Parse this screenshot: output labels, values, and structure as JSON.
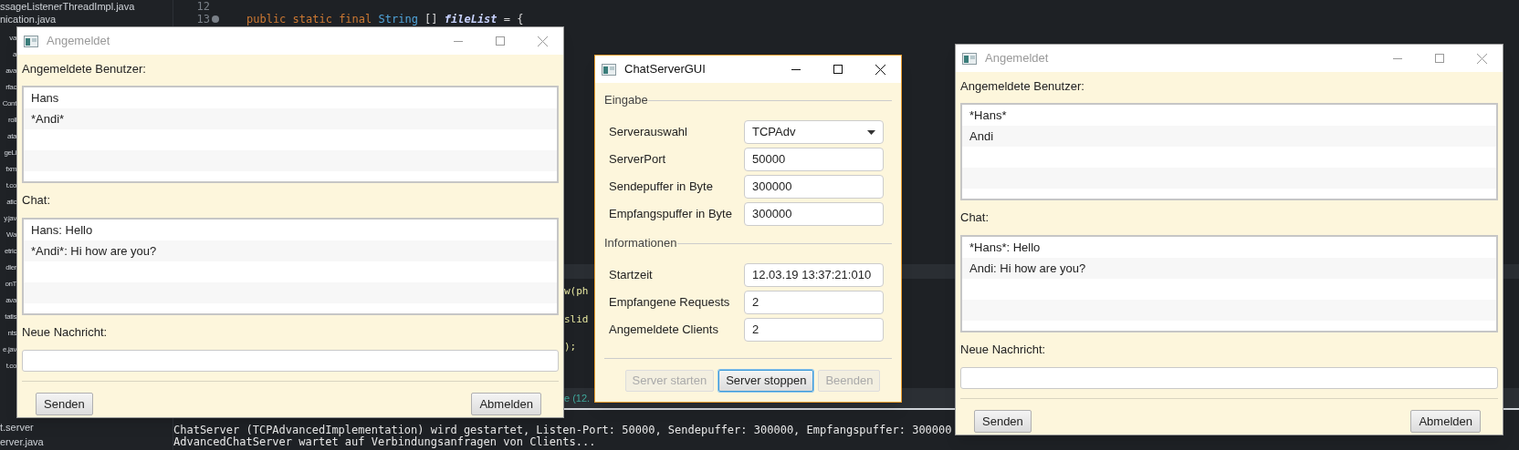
{
  "ide": {
    "file_tree": [
      "ssageListenerThreadImpl.java",
      "nication.java",
      "va",
      "a",
      "ava",
      "rfac",
      "Cont",
      "roll",
      "ata",
      "geLi",
      "fxm",
      "t.co",
      "atic",
      "y.jav",
      "Wa",
      "etric",
      "dler",
      "onT",
      "ava",
      "tatis",
      "nts",
      "e.jav",
      "t.co",
      "t.server",
      "erver.java"
    ],
    "editor": {
      "lines": [
        {
          "number": "12",
          "folded": false
        },
        {
          "number": "13",
          "folded": true,
          "tokens": [
            {
              "kind": "keyword",
              "text": "public static final"
            },
            {
              "kind": "type",
              "text": "String"
            },
            {
              "kind": "plain",
              "text": "[]"
            },
            {
              "kind": "field",
              "text": "fileList"
            },
            {
              "kind": "plain",
              "text": "= {"
            }
          ]
        }
      ],
      "fragments": [
        "w(ph",
        "slid",
        ");"
      ]
    },
    "console_tab": "e (12.",
    "console": [
      "ChatServer (TCPAdvancedImplementation) wird gestartet, Listen-Port: 50000, Sendepuffer: 300000, Empfangspuffer: 300000",
      "AdvancedChatServer wartet auf Verbindungsanfragen von Clients..."
    ]
  },
  "windows": [
    {
      "kind": "client",
      "title": "Angemeldet",
      "active": false,
      "users_label": "Angemeldete Benutzer:",
      "users": [
        "Hans",
        "*Andi*"
      ],
      "chat_label": "Chat:",
      "messages": [
        "Hans: Hello",
        "*Andi*: Hi how are you?"
      ],
      "message_label": "Neue Nachricht:",
      "buttons": [
        {
          "label": "Senden"
        },
        {
          "label": "Abmelden"
        }
      ]
    },
    {
      "kind": "server",
      "title": "ChatServerGUI",
      "active": true,
      "sections": [
        {
          "title": "Eingabe",
          "rows": [
            {
              "label": "Serverauswahl",
              "kind": "dropdown",
              "value": "TCPAdv"
            },
            {
              "label": "ServerPort",
              "kind": "text",
              "value": "50000"
            },
            {
              "label": "Sendepuffer in Byte",
              "kind": "text",
              "value": "300000"
            },
            {
              "label": "Empfangspuffer in Byte",
              "kind": "text",
              "value": "300000"
            }
          ]
        },
        {
          "title": "Informationen",
          "rows": [
            {
              "label": "Startzeit",
              "kind": "text",
              "value": "12.03.19 13:37:21:010"
            },
            {
              "label": "Empfangene Requests",
              "kind": "text",
              "value": "2"
            },
            {
              "label": "Angemeldete Clients",
              "kind": "text",
              "value": "2"
            }
          ]
        }
      ],
      "buttons": [
        {
          "label": "Server starten",
          "disabled": true,
          "focused": false
        },
        {
          "label": "Server stoppen",
          "disabled": false,
          "focused": true
        },
        {
          "label": "Beenden",
          "disabled": true,
          "focused": false
        }
      ]
    },
    {
      "kind": "client",
      "title": "Angemeldet",
      "active": false,
      "users_label": "Angemeldete Benutzer:",
      "users": [
        "*Hans*",
        "Andi"
      ],
      "chat_label": "Chat:",
      "messages": [
        "*Hans*: Hello",
        "Andi: Hi how are you?"
      ],
      "message_label": "Neue Nachricht:",
      "buttons": [
        {
          "label": "Senden"
        },
        {
          "label": "Abmelden"
        }
      ]
    }
  ]
}
